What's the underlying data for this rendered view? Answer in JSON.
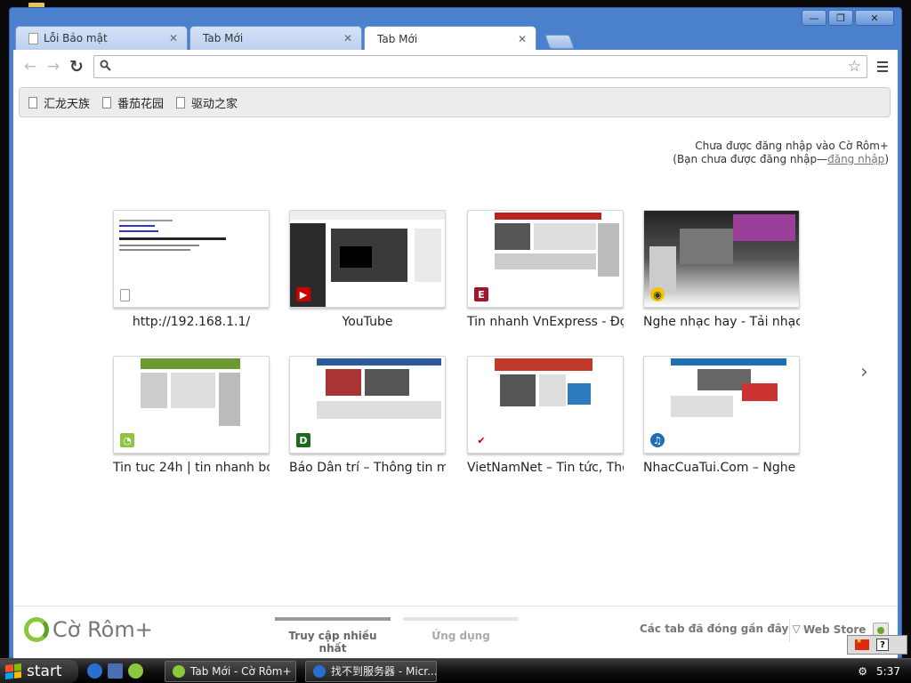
{
  "window": {
    "controls": [
      "—",
      "❐",
      "✕"
    ]
  },
  "tabs": [
    {
      "title": "Lỗi Bảo mật",
      "active": false
    },
    {
      "title": "Tab Mới",
      "active": false
    },
    {
      "title": "Tab Mới",
      "active": true
    }
  ],
  "toolbar": {
    "back_icon": "←",
    "forward_icon": "→",
    "reload_icon": "↻",
    "omnibox_value": "",
    "omnibox_placeholder": ""
  },
  "bookmarks": [
    {
      "label": "汇龙天族"
    },
    {
      "label": "番茄花园"
    },
    {
      "label": "驱动之家"
    }
  ],
  "signin": {
    "line1": "Chưa được đăng nhập vào Cờ Rôm+",
    "line2_prefix": "(Bạn chưa được đăng nhập—",
    "line2_link": "đăng nhập",
    "line2_suffix": ")"
  },
  "most_visited": [
    {
      "label": "http://192.168.1.1/",
      "favicon": "page-icon"
    },
    {
      "label": "YouTube",
      "favicon": "youtube-icon"
    },
    {
      "label": "Tin nhanh VnExpress - Đọ...",
      "favicon": "vnexpress-icon"
    },
    {
      "label": "Nghe nhạc hay - Tải nhạc ...",
      "favicon": "zing-icon"
    },
    {
      "label": "Tin tuc 24h | tin nhanh bo...",
      "favicon": "24h-icon"
    },
    {
      "label": "Báo Dân trí – Thông tin m...",
      "favicon": "dantri-icon"
    },
    {
      "label": "VietNamNet – Tin tức, Thời...",
      "favicon": "vietnamnet-icon"
    },
    {
      "label": "NhacCuaTui.Com – Nghe ...",
      "favicon": "nhaccuatui-icon"
    }
  ],
  "next_arrow": "›",
  "footer": {
    "brand": "Cờ Rôm+",
    "section_most_visited": "Truy cập nhiều nhất",
    "section_apps": "Ứng dụng",
    "recent_tabs": "Các tab đã đóng gần đây ▽",
    "web_store": "Web Store"
  },
  "taskbar": {
    "start_label": "start",
    "tasks": [
      {
        "label": "Tab Mới - Cờ Rôm+"
      },
      {
        "label": "找不到服务器 - Micr..."
      }
    ],
    "clock": "5:37",
    "help": "?"
  },
  "colors": {
    "frame": "#4a80cc",
    "brand_green": "#8cc63f"
  }
}
